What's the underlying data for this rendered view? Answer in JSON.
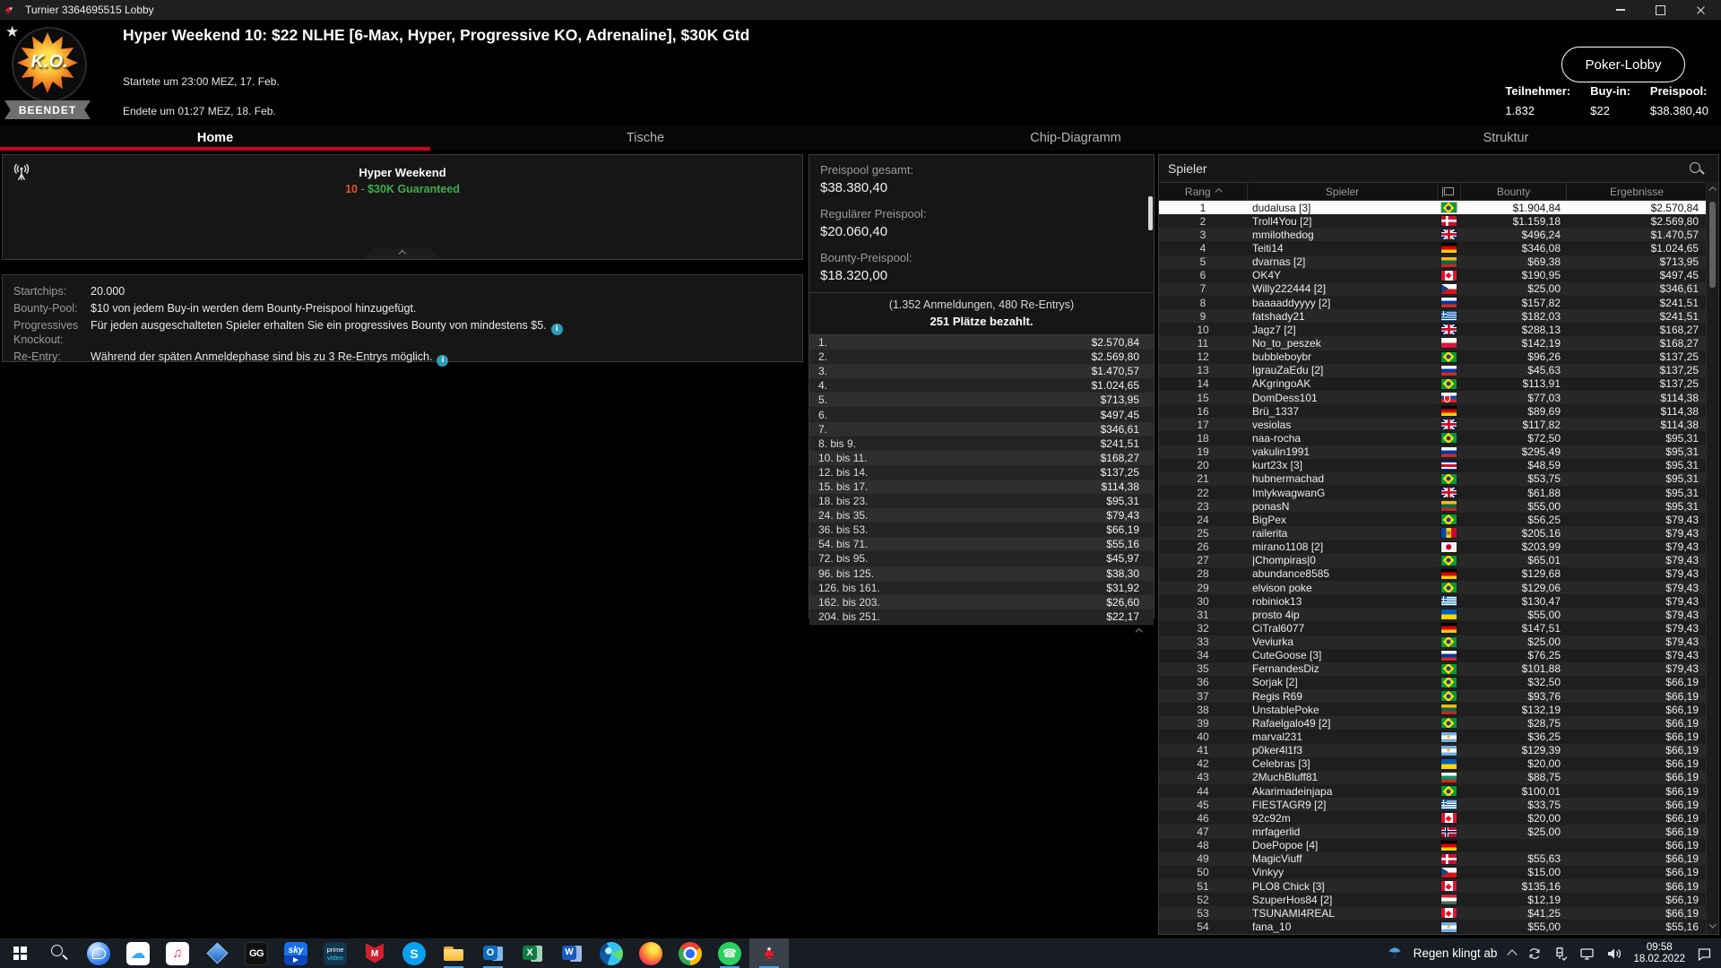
{
  "colors": {
    "accent_red": "#d0021b",
    "guarantee_green": "#3fae49",
    "event_red": "#e0532f",
    "info_teal": "#2f9db8",
    "running_blue": "#4aa0e8"
  },
  "titlebar": {
    "title": "Turnier 3364695515 Lobby"
  },
  "header": {
    "logo_text": "K.O.",
    "status_badge": "BEENDET",
    "title": "Hyper Weekend 10: $22 NLHE [6-Max, Hyper, Progressive KO, Adrenaline], $30K Gtd",
    "started": "Startete um 23:00 MEZ, 17. Feb.",
    "ended": "Endete um 01:27 MEZ, 18. Feb.",
    "lobby_button": "Poker-Lobby",
    "stats": {
      "teilnehmer_label": "Teilnehmer:",
      "teilnehmer": "1.832",
      "buyin_label": "Buy-in:",
      "buyin": "$22",
      "preispool_label": "Preispool:",
      "preispool": "$38.380,40"
    }
  },
  "tabs": [
    {
      "label": "Home",
      "active": true
    },
    {
      "label": "Tische",
      "active": false
    },
    {
      "label": "Chip-Diagramm",
      "active": false
    },
    {
      "label": "Struktur",
      "active": false
    }
  ],
  "tournament_info": {
    "series": "Hyper Weekend",
    "event_number": "10",
    "separator": " - ",
    "guarantee": "$30K Guaranteed",
    "rows": [
      {
        "label": "Startchips:",
        "value": "20.000"
      },
      {
        "label": "Bounty-Pool:",
        "value": "$10 von jedem Buy-in werden dem Bounty-Preispool hinzugefügt."
      },
      {
        "label": "Progressives Knockout:",
        "value": "Für jeden ausgeschalteten Spieler erhalten Sie ein progressives Bounty von mindestens $5."
      },
      {
        "label": "Re-Entry:",
        "value": "Während der späten Anmeldephase sind bis zu 3 Re-Entrys möglich."
      }
    ]
  },
  "prizepool": {
    "total_label": "Preispool gesamt:",
    "total": "$38.380,40",
    "regular_label": "Regulärer Preispool:",
    "regular": "$20.060,40",
    "bounty_label": "Bounty-Preispool:",
    "bounty": "$18.320,00",
    "entries_line": "(1.352 Anmeldungen, 480 Re-Entrys)",
    "paid_line": "251 Plätze bezahlt.",
    "prizes": [
      [
        "1.",
        "$2.570,84"
      ],
      [
        "2.",
        "$2.569,80"
      ],
      [
        "3.",
        "$1.470,57"
      ],
      [
        "4.",
        "$1.024,65"
      ],
      [
        "5.",
        "$713,95"
      ],
      [
        "6.",
        "$497,45"
      ],
      [
        "7.",
        "$346,61"
      ],
      [
        "8. bis 9.",
        "$241,51"
      ],
      [
        "10. bis 11.",
        "$168,27"
      ],
      [
        "12. bis 14.",
        "$137,25"
      ],
      [
        "15. bis 17.",
        "$114,38"
      ],
      [
        "18. bis 23.",
        "$95,31"
      ],
      [
        "24. bis 35.",
        "$79,43"
      ],
      [
        "36. bis 53.",
        "$66,19"
      ],
      [
        "54. bis 71.",
        "$55,16"
      ],
      [
        "72. bis 95.",
        "$45,97"
      ],
      [
        "96. bis 125.",
        "$38,30"
      ],
      [
        "126. bis 161.",
        "$31,92"
      ],
      [
        "162. bis 203.",
        "$26,60"
      ],
      [
        "204. bis 251.",
        "$22,17"
      ]
    ]
  },
  "players": {
    "panel_title": "Spieler",
    "columns": [
      "Rang",
      "Spieler",
      "Bounty",
      "Ergebnisse"
    ],
    "rows": [
      [
        "1",
        "dudalusa [3]",
        "br",
        "$1.904,84",
        "$2.570,84"
      ],
      [
        "2",
        "Troll4You [2]",
        "dk",
        "$1.159,18",
        "$2.569,80"
      ],
      [
        "3",
        "mmilothedog",
        "gb",
        "$496,24",
        "$1.470,57"
      ],
      [
        "4",
        "Teiti14",
        "de",
        "$346,08",
        "$1.024,65"
      ],
      [
        "5",
        "dvarnas [2]",
        "lt",
        "$69,38",
        "$713,95"
      ],
      [
        "6",
        "OK4Y",
        "ca",
        "$190,95",
        "$497,45"
      ],
      [
        "7",
        "Willy222444 [2]",
        "cz",
        "$25,00",
        "$346,61"
      ],
      [
        "8",
        "baaaaddyyyy [2]",
        "ru",
        "$157,82",
        "$241,51"
      ],
      [
        "9",
        "fatshady21",
        "gr",
        "$182,03",
        "$241,51"
      ],
      [
        "10",
        "Jagz7 [2]",
        "gb",
        "$288,13",
        "$168,27"
      ],
      [
        "11",
        "No_to_peszek",
        "pl",
        "$142,19",
        "$168,27"
      ],
      [
        "12",
        "bubbleboybr",
        "br",
        "$96,26",
        "$137,25"
      ],
      [
        "13",
        "IgrauZaEdu [2]",
        "ru",
        "$45,63",
        "$137,25"
      ],
      [
        "14",
        "AKgringoAK",
        "br",
        "$113,91",
        "$137,25"
      ],
      [
        "15",
        "DomDess101",
        "sk",
        "$77,03",
        "$114,38"
      ],
      [
        "16",
        "Brü_1337",
        "de",
        "$89,69",
        "$114,38"
      ],
      [
        "17",
        "vesiolas",
        "gb",
        "$117,82",
        "$114,38"
      ],
      [
        "18",
        "naa-rocha",
        "br",
        "$72,50",
        "$95,31"
      ],
      [
        "19",
        "vakulin1991",
        "ru",
        "$295,49",
        "$95,31"
      ],
      [
        "20",
        "kurt23x [3]",
        "cr",
        "$48,59",
        "$95,31"
      ],
      [
        "21",
        "hubnermachad",
        "br",
        "$53,75",
        "$95,31"
      ],
      [
        "22",
        "ImlykwagwanG",
        "gb",
        "$61,88",
        "$95,31"
      ],
      [
        "23",
        "ponasN",
        "lt",
        "$55,00",
        "$95,31"
      ],
      [
        "24",
        "BigPex",
        "br",
        "$56,25",
        "$79,43"
      ],
      [
        "25",
        "railerita",
        "md",
        "$205,16",
        "$79,43"
      ],
      [
        "26",
        "mirano1108 [2]",
        "jp",
        "$203,99",
        "$79,43"
      ],
      [
        "27",
        "|Chompiras|0",
        "br",
        "$65,01",
        "$79,43"
      ],
      [
        "28",
        "abundance8585",
        "de",
        "$129,68",
        "$79,43"
      ],
      [
        "29",
        "elvison poke",
        "br",
        "$129,06",
        "$79,43"
      ],
      [
        "30",
        "robiniok13",
        "gr",
        "$130,47",
        "$79,43"
      ],
      [
        "31",
        "prosto 4ip",
        "ua",
        "$55,00",
        "$79,43"
      ],
      [
        "32",
        "CiTral6077",
        "de",
        "$147,51",
        "$79,43"
      ],
      [
        "33",
        "Veviurka",
        "br",
        "$25,00",
        "$79,43"
      ],
      [
        "34",
        "CuteGoose [3]",
        "ru",
        "$76,25",
        "$79,43"
      ],
      [
        "35",
        "FernandesDiz",
        "br",
        "$101,88",
        "$79,43"
      ],
      [
        "36",
        "Sorjak [2]",
        "br",
        "$32,50",
        "$66,19"
      ],
      [
        "37",
        "Regis R69",
        "br",
        "$93,76",
        "$66,19"
      ],
      [
        "38",
        "UnstablePoke",
        "lt",
        "$132,19",
        "$66,19"
      ],
      [
        "39",
        "Rafaelgalo49 [2]",
        "br",
        "$28,75",
        "$66,19"
      ],
      [
        "40",
        "marval231",
        "ar",
        "$36,25",
        "$66,19"
      ],
      [
        "41",
        "p0ker4l1f3",
        "ar",
        "$129,39",
        "$66,19"
      ],
      [
        "42",
        "Celebras [3]",
        "ua",
        "$20,00",
        "$66,19"
      ],
      [
        "43",
        "2MuchBluff81",
        "bg",
        "$88,75",
        "$66,19"
      ],
      [
        "44",
        "Akarimadeinjapa",
        "br",
        "$100,01",
        "$66,19"
      ],
      [
        "45",
        "FIESTAGR9 [2]",
        "gr",
        "$33,75",
        "$66,19"
      ],
      [
        "46",
        "92c92m",
        "ca",
        "$20,00",
        "$66,19"
      ],
      [
        "47",
        "mrfagerlid",
        "no",
        "$25,00",
        "$66,19"
      ],
      [
        "48",
        "DoePopoe [4]",
        "de",
        "",
        "$66,19"
      ],
      [
        "49",
        "MagicViuff",
        "dk",
        "$55,63",
        "$66,19"
      ],
      [
        "50",
        "Vinkyy",
        "cz",
        "$15,00",
        "$66,19"
      ],
      [
        "51",
        "PLO8 Chick [3]",
        "ca",
        "$135,16",
        "$66,19"
      ],
      [
        "52",
        "SzuperHos84 [2]",
        "hu",
        "$12,19",
        "$66,19"
      ],
      [
        "53",
        "TSUNAMI4REAL",
        "ca",
        "$41,25",
        "$66,19"
      ],
      [
        "54",
        "fana_10",
        "ar",
        "$55,00",
        "$55,16"
      ],
      [
        "55",
        "",
        "",
        "",
        ""
      ]
    ]
  },
  "taskbar": {
    "apps": [
      "start",
      "search",
      "chat",
      "icloud",
      "music",
      "diamond",
      "ggpoker",
      "sky",
      "prime",
      "mcafee",
      "skype",
      "explorer",
      "outlook",
      "excel",
      "word",
      "edge",
      "firefox",
      "chrome",
      "whatsapp",
      "pokerstars"
    ],
    "running": [
      "explorer",
      "outlook",
      "whatsapp",
      "pokerstars"
    ],
    "active": "pokerstars",
    "weather": "Regen klingt ab",
    "time": "09:58",
    "date": "18.02.2022"
  }
}
